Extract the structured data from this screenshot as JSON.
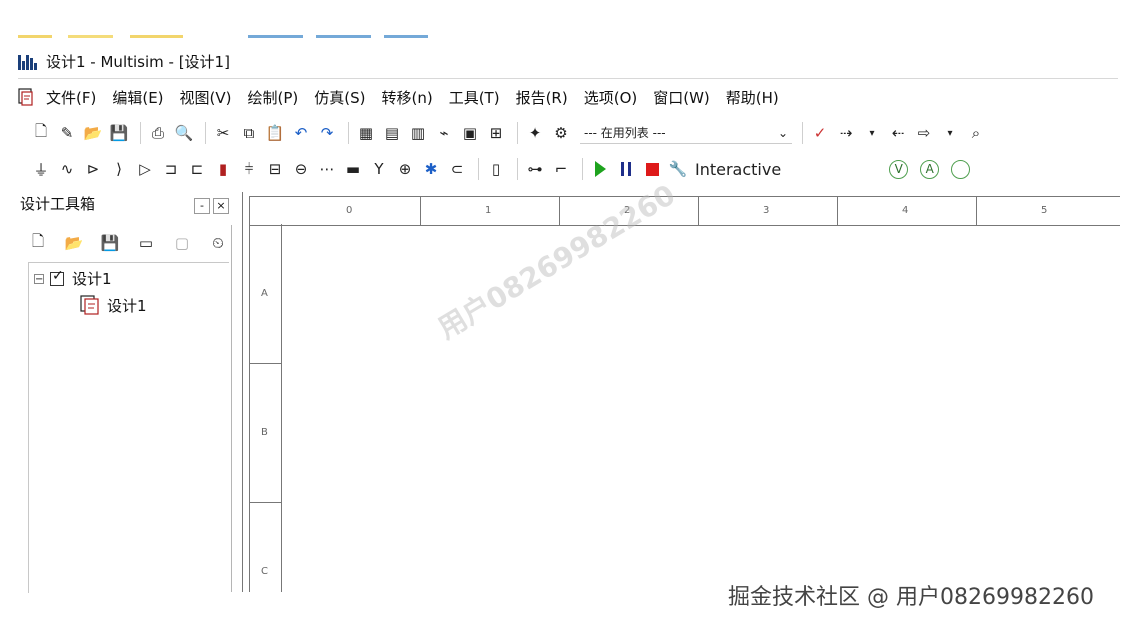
{
  "window": {
    "title": "设计1 - Multisim - [设计1]"
  },
  "menu": {
    "items": [
      "文件(F)",
      "编辑(E)",
      "视图(V)",
      "绘制(P)",
      "仿真(S)",
      "转移(n)",
      "工具(T)",
      "报告(R)",
      "选项(O)",
      "窗口(W)",
      "帮助(H)"
    ]
  },
  "toolbar": {
    "in_use_list_placeholder": "--- 在用列表 ---",
    "simulation_mode_label": "Interactive"
  },
  "design_toolbox": {
    "title": "设计工具箱",
    "minimize_glyph": "-",
    "close_glyph": "×",
    "tree": {
      "root_label": "设计1",
      "child_label": "设计1"
    }
  },
  "canvas": {
    "column_labels": [
      "0",
      "1",
      "2",
      "3",
      "4",
      "5"
    ],
    "row_labels": [
      "A",
      "B",
      "C"
    ]
  },
  "watermarks": {
    "diagonal_text": "用户08269982260",
    "footer_text": "掘金技术社区 @ 用户08269982260"
  },
  "colors": {
    "play": "#1ea31e",
    "pause": "#1f2f8a",
    "stop": "#de1a1a",
    "accent": "#1a3f7a"
  }
}
